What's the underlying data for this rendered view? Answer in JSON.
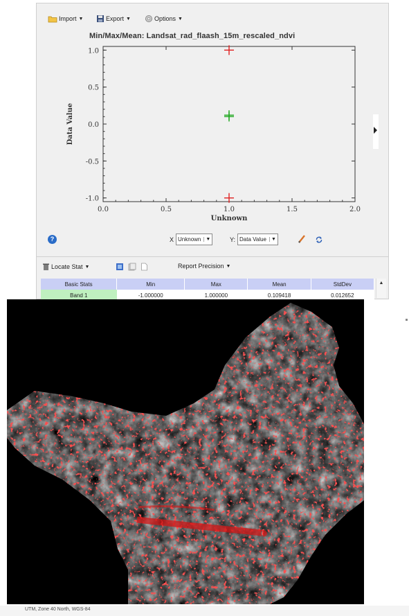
{
  "toolbar": {
    "import_label": "Import",
    "export_label": "Export",
    "options_label": "Options"
  },
  "plot": {
    "title": "Min/Max/Mean: Landsat_rad_flaash_15m_rescaled_ndvi",
    "x_axis_label": "Unknown",
    "y_axis_label": "Data Value",
    "x_ticks": [
      "0.0",
      "0.5",
      "1.0",
      "1.5",
      "2.0"
    ],
    "y_ticks": [
      "1.0",
      "0.5",
      "0.0",
      "-0.5",
      "-1.0"
    ]
  },
  "chart_data": {
    "type": "scatter",
    "title": "Min/Max/Mean: Landsat_rad_flaash_15m_rescaled_ndvi",
    "xlabel": "Unknown",
    "ylabel": "Data Value",
    "xlim": [
      0.0,
      2.0
    ],
    "ylim": [
      -1.05,
      1.05
    ],
    "grid": false,
    "marker": "plus",
    "series": [
      {
        "x": [
          1.0
        ],
        "y": [
          1.0
        ],
        "color": "#e02020"
      },
      {
        "x": [
          1.0,
          1.0
        ],
        "y": [
          0.1,
          0.12
        ],
        "color": "#1fa81f"
      },
      {
        "x": [
          1.0
        ],
        "y": [
          -1.0
        ],
        "color": "#e02020"
      }
    ]
  },
  "axis_selectors": {
    "x_prefix": "X",
    "x_value": "Unknown",
    "y_prefix": "Y:",
    "y_value": "Data Value"
  },
  "bottom_toolbar": {
    "locate_stat_label": "Locate Stat",
    "report_precision_label": "Report Precision"
  },
  "stats_table": {
    "headers": [
      "Basic Stats",
      "Min",
      "Max",
      "Mean",
      "StdDev"
    ],
    "rows": [
      [
        "Band 1",
        "-1.000000",
        "1.000000",
        "0.109418",
        "0.012652"
      ]
    ]
  },
  "status_bar": {
    "text": "UTM, Zone 40 North, WGS-84"
  },
  "colors": {
    "panel_bg": "#f0f0f0",
    "table_header": "#c9cff5",
    "row_header": "#bff0bf",
    "marker_red": "#e02020",
    "marker_green": "#1fa81f"
  }
}
